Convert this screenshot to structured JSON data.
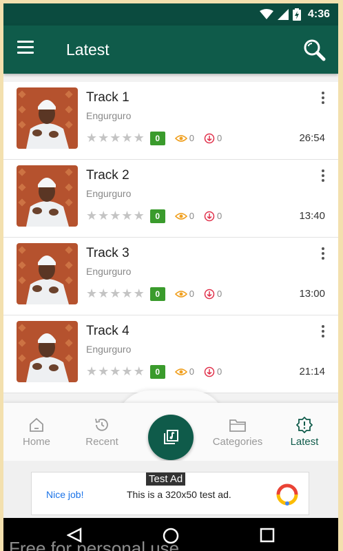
{
  "status_bar": {
    "time": "4:36"
  },
  "app_bar": {
    "title": "Latest"
  },
  "tracks": [
    {
      "title": "Track 1",
      "artist": "Engurguro",
      "rating": "0",
      "views": "0",
      "downloads": "0",
      "duration": "26:54"
    },
    {
      "title": "Track 2",
      "artist": "Engurguro",
      "rating": "0",
      "views": "0",
      "downloads": "0",
      "duration": "13:40"
    },
    {
      "title": "Track 3",
      "artist": "Engurguro",
      "rating": "0",
      "views": "0",
      "downloads": "0",
      "duration": "13:00"
    },
    {
      "title": "Track 4",
      "artist": "Engurguro",
      "rating": "0",
      "views": "0",
      "downloads": "0",
      "duration": "21:14"
    }
  ],
  "bottom_nav": {
    "home": "Home",
    "recent": "Recent",
    "categories": "Categories",
    "latest": "Latest",
    "active": "latest"
  },
  "ad": {
    "label": "Test Ad",
    "nice": "Nice job!",
    "text": "This is a 320x50 test ad."
  },
  "watermark": "Free for personal use",
  "colors": {
    "primary": "#0f5b4a",
    "status_bar": "#0b4b3f",
    "rating_badge": "#3a9b2c",
    "views_icon": "#f0a020",
    "downloads_icon": "#e0304a"
  },
  "icons": {
    "menu": "hamburger-icon",
    "search": "search-icon",
    "more": "more-vertical-icon",
    "views": "eye-icon",
    "downloads": "download-icon",
    "home": "home-icon",
    "recent": "history-icon",
    "fab": "music-library-icon",
    "categories": "folder-icon",
    "latest": "new-badge-icon"
  }
}
